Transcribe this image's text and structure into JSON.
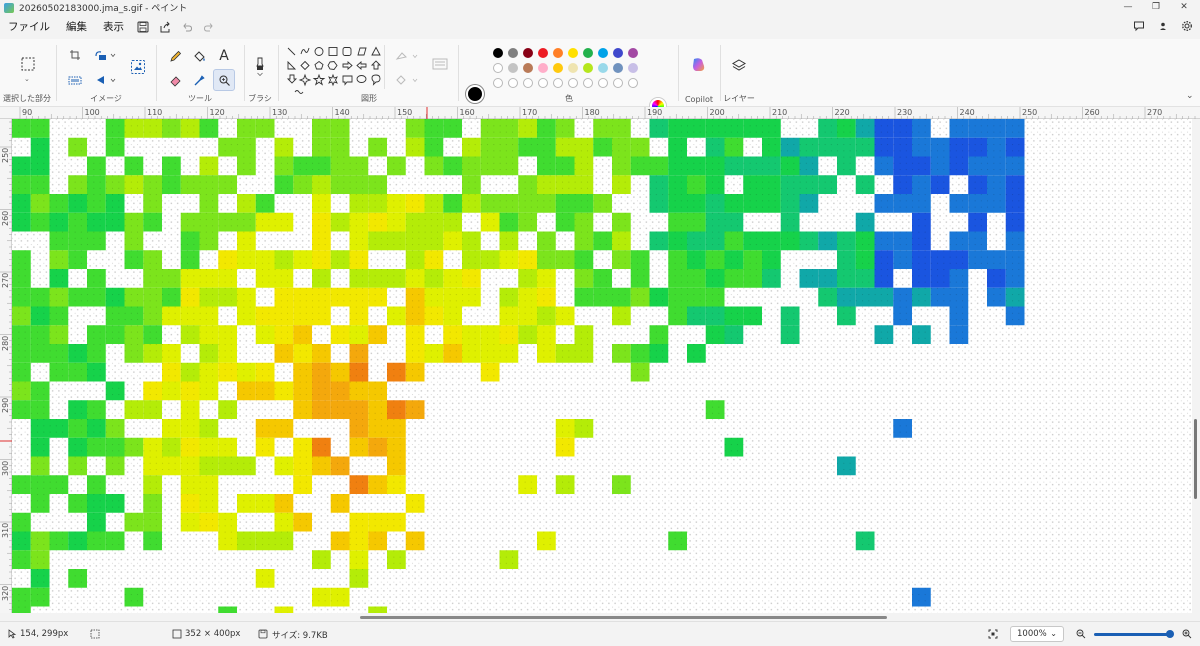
{
  "window": {
    "title": "20260502183000.jma_s.gif - ペイント",
    "minimize_glyph": "—",
    "maximize_glyph": "❐",
    "close_glyph": "✕"
  },
  "menu": {
    "file": "ファイル",
    "edit": "編集",
    "view": "表示"
  },
  "ribbon": {
    "groups": {
      "selection": "選択した部分",
      "image": "イメージ",
      "tools": "ツール",
      "brushes": "ブラシ",
      "shapes": "図形",
      "colors": "色",
      "copilot": "Copilot",
      "layers": "レイヤー"
    },
    "palette_top": [
      "#000000",
      "#7f7f7f",
      "#880015",
      "#ed1c24",
      "#ff7f27",
      "#ffe000",
      "#22b14c",
      "#00a2e8",
      "#3f48cc",
      "#a349a4"
    ],
    "palette_mid": [
      "#ffffff",
      "#c3c3c3",
      "#b97a57",
      "#ffaec9",
      "#ffc90e",
      "#efe4b0",
      "#b5e61d",
      "#99d9ea",
      "#7092be",
      "#c8bfe7"
    ],
    "primary_color": "#000000",
    "secondary_color": "#ffffff"
  },
  "ruler_top": [
    "90",
    "100",
    "110",
    "120",
    "130",
    "140",
    "150",
    "160",
    "170",
    "180",
    "190",
    "200",
    "210",
    "220",
    "230",
    "240",
    "250",
    "260",
    "270"
  ],
  "ruler_left": [
    "250",
    "260",
    "270",
    "280",
    "290",
    "300",
    "310",
    "320"
  ],
  "status": {
    "cursor_pos": "154, 299px",
    "canvas_size": "352 × 400px",
    "file_size": "サイズ: 9.7KB",
    "zoom": "1000%"
  },
  "canvas_image": {
    "cell_colors": [
      "#16d24a",
      "#40dc30",
      "#7ce41c",
      "#b4ec08",
      "#dff000",
      "#f2e800",
      "#f5c800",
      "#f4a80c",
      "#f08010",
      "#14c870",
      "#10a8a8",
      "#1a78d8",
      "#1a55e0"
    ]
  }
}
